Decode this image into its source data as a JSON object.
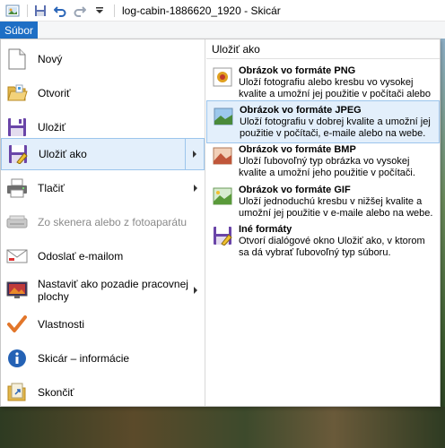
{
  "window": {
    "title": "log-cabin-1886620_1920 - Skicár"
  },
  "quick_access": {
    "save_icon": "save-icon",
    "undo_icon": "undo-icon",
    "redo_icon": "redo-icon",
    "customize_icon": "dropdown-icon"
  },
  "ribbon": {
    "file_tab": "Súbor"
  },
  "file_menu": {
    "items": [
      {
        "label": "Nový",
        "icon": "new-document-icon"
      },
      {
        "label": "Otvoriť",
        "icon": "open-folder-icon"
      },
      {
        "label": "Uložiť",
        "icon": "save-icon"
      },
      {
        "label": "Uložiť ako",
        "icon": "save-as-icon"
      },
      {
        "label": "Tlačiť",
        "icon": "printer-icon"
      },
      {
        "label": "Zo skenera alebo z fotoaparátu",
        "icon": "scanner-icon"
      },
      {
        "label": "Odoslať e-mailom",
        "icon": "email-icon"
      },
      {
        "label": "Nastaviť ako pozadie pracovnej plochy",
        "icon": "desktop-background-icon"
      },
      {
        "label": "Vlastnosti",
        "icon": "checkmark-icon"
      },
      {
        "label": "Skicár – informácie",
        "icon": "info-icon"
      },
      {
        "label": "Skončiť",
        "icon": "exit-icon"
      }
    ]
  },
  "save_as_submenu": {
    "header": "Uložiť ako",
    "items": [
      {
        "title": "Obrázok vo formáte PNG",
        "description": "Uloží fotografiu alebo kresbu vo vysokej kvalite a umožní jej použitie v počítači alebo na webe.",
        "icon": "png-image-icon"
      },
      {
        "title": "Obrázok vo formáte JPEG",
        "description": "Uloží fotografiu v dobrej kvalite a umožní jej použitie v počítači, e-maile alebo na webe.",
        "icon": "jpeg-image-icon"
      },
      {
        "title": "Obrázok vo formáte BMP",
        "description": "Uloží ľubovoľný typ obrázka vo vysokej kvalite a umožní jeho použitie v počítači.",
        "icon": "bmp-image-icon"
      },
      {
        "title": "Obrázok vo formáte GIF",
        "description": "Uloží jednoduchú kresbu v nižšej kvalite a umožní jej použitie v e-maile alebo na webe.",
        "icon": "gif-image-icon"
      },
      {
        "title": "Iné formáty",
        "description": "Otvorí dialógové okno Uložiť ako, v ktorom sa dá vybrať ľubovoľný typ súboru.",
        "icon": "other-formats-icon"
      }
    ]
  },
  "colors": {
    "file_tab": "#1e6fc5",
    "selection_bg": "#e3effb",
    "selection_border": "#9cc5ec"
  }
}
